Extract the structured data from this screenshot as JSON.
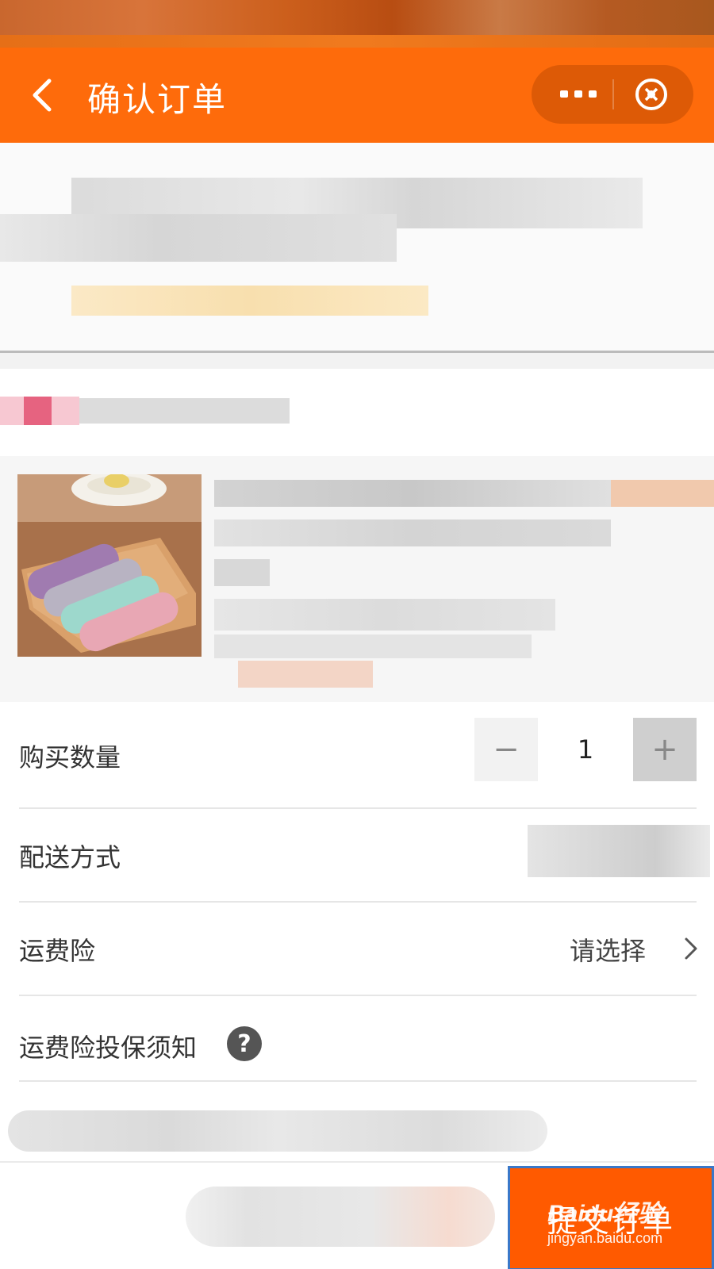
{
  "header": {
    "title": "确认订单",
    "back_icon": "chevron-left-icon",
    "more_icon": "more-dots-icon",
    "close_icon": "close-mini-program-icon",
    "background_color": "#fe6b0b"
  },
  "order": {
    "quantity_label": "购买数量",
    "quantity_value": "1",
    "minus_symbol": "−",
    "plus_symbol": "+",
    "delivery_label": "配送方式",
    "insurance_label": "运费险",
    "insurance_value": "请选择",
    "insurance_notice_label": "运费险投保须知",
    "help_symbol": "?"
  },
  "footer": {
    "submit_label": "提交订单",
    "submit_color": "#ff5a00"
  },
  "watermark": {
    "logo": "Baidu经验",
    "url": "jingyan.baidu.com"
  }
}
